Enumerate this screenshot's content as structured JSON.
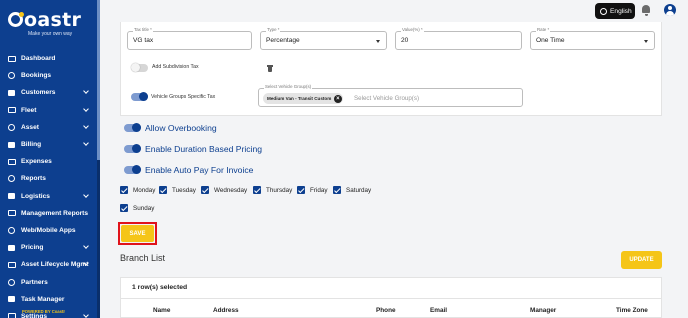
{
  "brand": {
    "name": "oastr",
    "tagline": "Make your own way",
    "powered": "POWERED BY Coastr"
  },
  "sidebar": {
    "items": [
      {
        "label": "Dashboard",
        "icon": "dashboard-icon",
        "chevron": false
      },
      {
        "label": "Bookings",
        "icon": "bookings-icon",
        "chevron": false
      },
      {
        "label": "Customers",
        "icon": "customers-icon",
        "chevron": true
      },
      {
        "label": "Fleet",
        "icon": "fleet-icon",
        "chevron": true
      },
      {
        "label": "Asset",
        "icon": "asset-icon",
        "chevron": true
      },
      {
        "label": "Billing",
        "icon": "billing-icon",
        "chevron": true
      },
      {
        "label": "Expenses",
        "icon": "expenses-icon",
        "chevron": false
      },
      {
        "label": "Reports",
        "icon": "reports-icon",
        "chevron": false
      },
      {
        "label": "Logistics",
        "icon": "logistics-icon",
        "chevron": true
      },
      {
        "label": "Management Reports",
        "icon": "management-reports-icon",
        "chevron": false
      },
      {
        "label": "Web/Mobile Apps",
        "icon": "apps-icon",
        "chevron": false
      },
      {
        "label": "Pricing",
        "icon": "pricing-icon",
        "chevron": true
      },
      {
        "label": "Asset Lifecycle Mgmt",
        "icon": "lifecycle-icon",
        "chevron": true
      },
      {
        "label": "Partners",
        "icon": "partners-icon",
        "chevron": false
      },
      {
        "label": "Task Manager",
        "icon": "task-manager-icon",
        "chevron": false
      },
      {
        "label": "Settings",
        "icon": "settings-icon",
        "chevron": true
      }
    ]
  },
  "topbar": {
    "language": "English"
  },
  "tax": {
    "tax_title_label": "Tax title *",
    "tax_title_value": "VG tax",
    "type_label": "Type *",
    "type_value": "Percentage",
    "value_label": "Value(%) *",
    "value_value": "20",
    "rate_label": "Rate *",
    "rate_value": "One Time",
    "add_subdivision_label": "Add Subdivision Tax",
    "vehicle_groups_label": "Vehicle Groups Specific Tax",
    "select_vg_label": "Select Vehicle Group(s)",
    "vg_chip": "Medium Van - Transit Custom",
    "vg_placeholder": "Select Vehicle Group(s)"
  },
  "options": {
    "allow_overbooking": "Allow Overbooking",
    "duration_pricing": "Enable Duration Based Pricing",
    "auto_pay": "Enable Auto Pay For Invoice"
  },
  "days": [
    "Monday",
    "Tuesday",
    "Wednesday",
    "Thursday",
    "Friday",
    "Saturday",
    "Sunday"
  ],
  "buttons": {
    "save": "SAVE",
    "update": "UPDATE"
  },
  "branch": {
    "title": "Branch List",
    "rows_selected": "1 row(s) selected",
    "columns": [
      "Name",
      "Address",
      "Phone",
      "Email",
      "Manager",
      "Time Zone"
    ]
  },
  "colors": {
    "primary": "#0d3f8f",
    "accent": "#f5c518",
    "highlight": "#e0131b"
  }
}
